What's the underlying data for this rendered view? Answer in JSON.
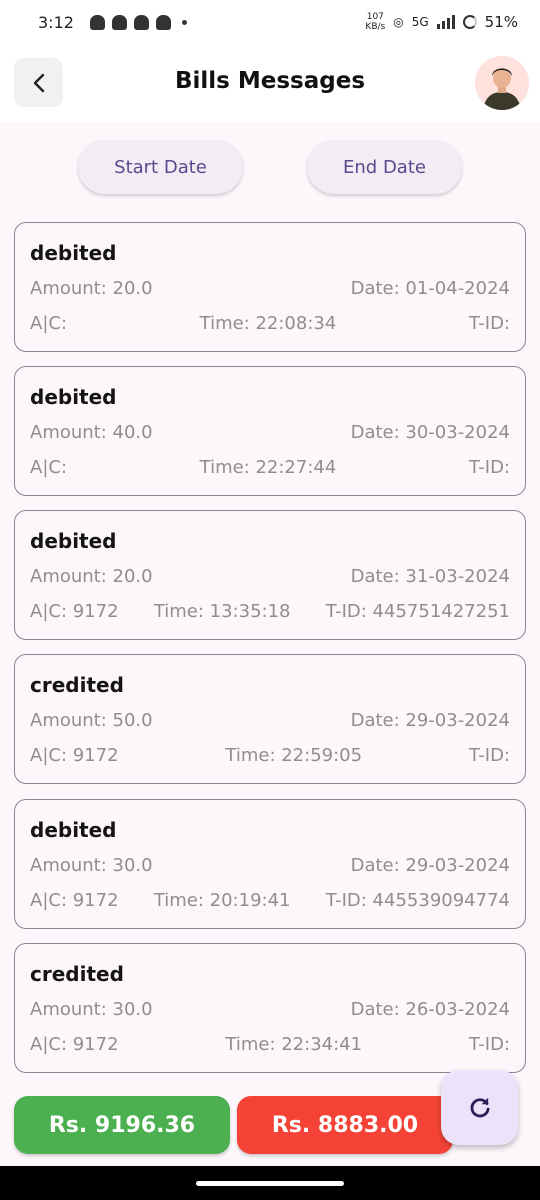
{
  "status": {
    "time": "3:12",
    "network_speed_value": "107",
    "network_speed_unit": "KB/s",
    "network_type": "5G",
    "battery": "51%"
  },
  "header": {
    "title": "Bills Messages",
    "back_icon": "chevron-left-icon",
    "avatar": "user-avatar"
  },
  "filters": {
    "start_date_label": "Start Date",
    "end_date_label": "End Date"
  },
  "messages": [
    {
      "type": "debited",
      "amount": "Amount: 20.0",
      "date": "Date: 01-04-2024",
      "account": "A|C:",
      "time": "Time: 22:08:34",
      "tid": "T-ID:"
    },
    {
      "type": "debited",
      "amount": "Amount: 40.0",
      "date": "Date: 30-03-2024",
      "account": "A|C:",
      "time": "Time: 22:27:44",
      "tid": "T-ID:"
    },
    {
      "type": "debited",
      "amount": "Amount: 20.0",
      "date": "Date: 31-03-2024",
      "account": "A|C: 9172",
      "time": "Time: 13:35:18",
      "tid": "T-ID: 445751427251"
    },
    {
      "type": "credited",
      "amount": "Amount: 50.0",
      "date": "Date: 29-03-2024",
      "account": "A|C: 9172",
      "time": "Time: 22:59:05",
      "tid": "T-ID:"
    },
    {
      "type": "debited",
      "amount": "Amount: 30.0",
      "date": "Date: 29-03-2024",
      "account": "A|C: 9172",
      "time": "Time: 20:19:41",
      "tid": "T-ID: 445539094774"
    },
    {
      "type": "credited",
      "amount": "Amount: 30.0",
      "date": "Date: 26-03-2024",
      "account": "A|C: 9172",
      "time": "Time: 22:34:41",
      "tid": "T-ID:"
    }
  ],
  "totals": {
    "credit": "Rs. 9196.36",
    "debit": "Rs. 8883.00",
    "credit_color": "#4caf50",
    "debit_color": "#f44336"
  },
  "fab": {
    "icon": "refresh-icon"
  }
}
